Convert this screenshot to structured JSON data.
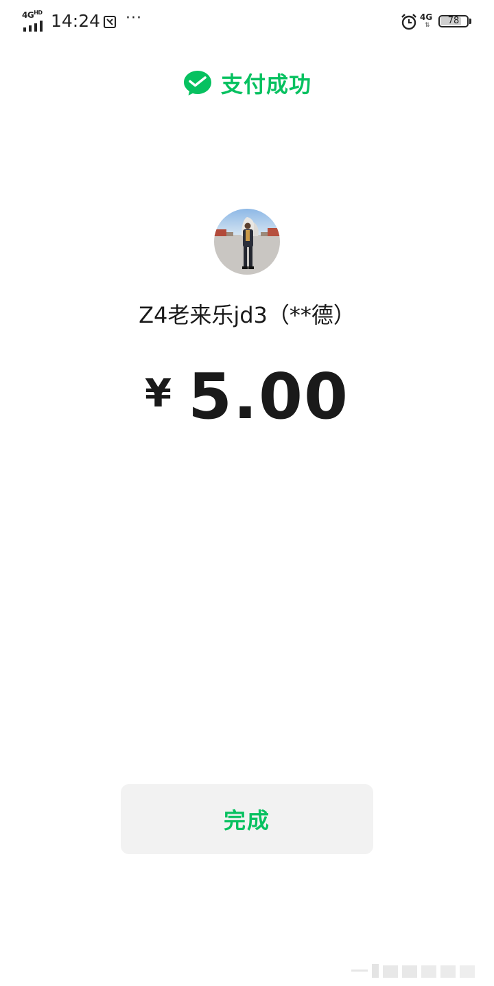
{
  "status_bar": {
    "network_left": "4G",
    "network_left_sup": "HD",
    "time": "14:24",
    "more_indicator": "···",
    "network_right": "4G",
    "battery_level": 78,
    "battery_text": "78",
    "icons": [
      "signal-icon",
      "screenshot-icon",
      "alarm-icon",
      "battery-icon"
    ]
  },
  "header": {
    "icon": "wechat-pay-icon",
    "title": "支付成功",
    "accent_color": "#07c160"
  },
  "payee": {
    "avatar": "avatar",
    "name": "Z4老来乐jd3（**德）"
  },
  "payment": {
    "currency_symbol": "¥",
    "amount": "5.00"
  },
  "actions": {
    "done_label": "完成"
  }
}
